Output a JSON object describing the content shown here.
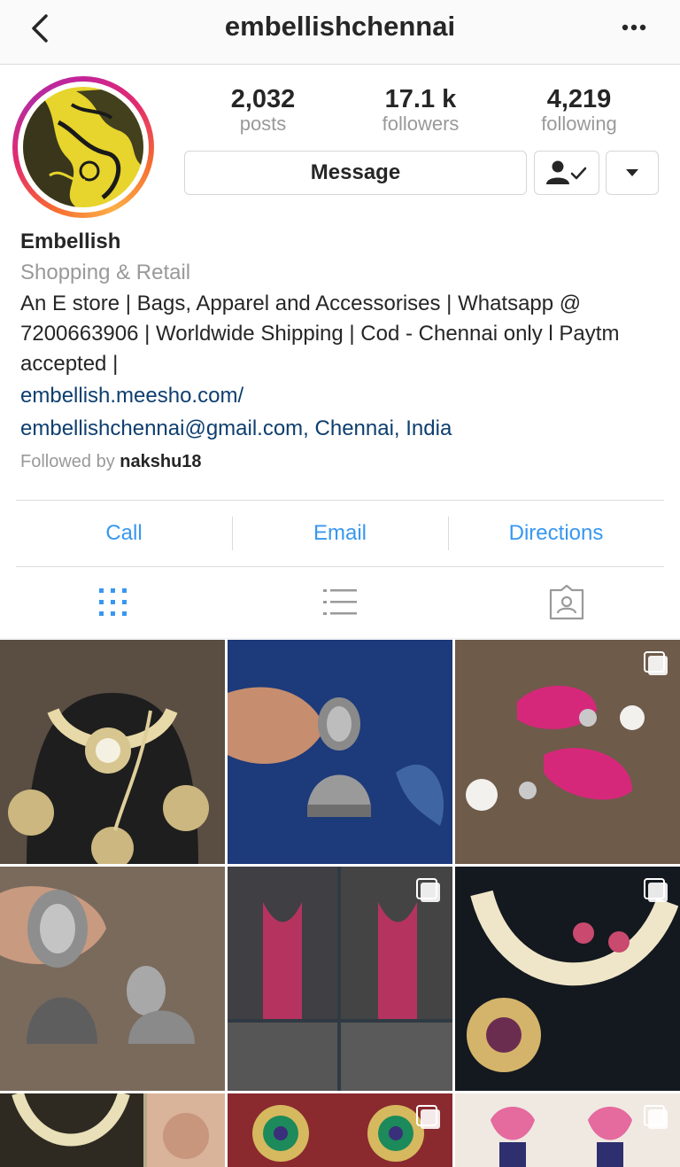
{
  "header": {
    "username": "embellishchennai",
    "back_icon": "chevron-left-icon",
    "more_icon": "more-dots-icon"
  },
  "profile": {
    "stats": [
      {
        "value": "2,032",
        "label": "posts"
      },
      {
        "value": "17.1 k",
        "label": "followers"
      },
      {
        "value": "4,219",
        "label": "following"
      }
    ],
    "message_label": "Message",
    "following_icon": "person-check-icon",
    "dropdown_icon": "caret-down-icon"
  },
  "bio": {
    "name": "Embellish",
    "category": "Shopping & Retail",
    "description": "An E store | Bags, Apparel and Accessorises | Whatsapp @ 7200663906 | Worldwide Shipping | Cod - Chennai only l Paytm accepted |",
    "website": "embellish.meesho.com/",
    "contact_line": "embellishchennai@gmail.com, Chennai, India",
    "followed_by_prefix": "Followed by",
    "followed_by_user": "nakshu18"
  },
  "actions": [
    "Call",
    "Email",
    "Directions"
  ],
  "tabs": [
    {
      "icon": "grid-icon",
      "active": true
    },
    {
      "icon": "list-icon",
      "active": false
    },
    {
      "icon": "tagged-icon",
      "active": false
    }
  ],
  "colors": {
    "link_blue": "#3897f0",
    "bio_link": "#0e3e6f",
    "muted": "#999999",
    "border": "#dbdbdb"
  },
  "posts": [
    {
      "subject": "kundan necklace set",
      "multi": false
    },
    {
      "subject": "oxidised jhumka earring",
      "multi": false
    },
    {
      "subject": "pink stone pearl earrings",
      "multi": true
    },
    {
      "subject": "oxidised face jhumkas",
      "multi": false
    },
    {
      "subject": "grey blazer collage",
      "multi": true
    },
    {
      "subject": "pearl necklace set",
      "multi": true
    },
    {
      "subject": "kundan choker collage",
      "multi": false
    },
    {
      "subject": "green stone earrings",
      "multi": true
    },
    {
      "subject": "pink lotus earrings",
      "multi": true
    }
  ]
}
